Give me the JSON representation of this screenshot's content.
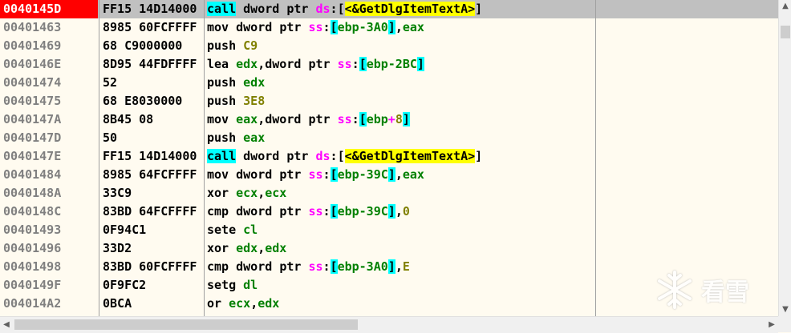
{
  "rows": [
    {
      "addr": "0040145D",
      "bytes": "FF15 14D14000",
      "mn": "call",
      "type": "call",
      "sel": true
    },
    {
      "addr": "00401463",
      "bytes": "8985 60FCFFFF",
      "mn": "mov",
      "type": "movstore",
      "mem": "ebp-3A0",
      "src": "eax"
    },
    {
      "addr": "00401469",
      "bytes": "68 C9000000",
      "mn": "push",
      "type": "pushimm",
      "op": "C9"
    },
    {
      "addr": "0040146E",
      "bytes": "8D95 44FDFFFF",
      "mn": "lea",
      "type": "lea",
      "reg": "edx",
      "mem": "ebp-2BC"
    },
    {
      "addr": "00401474",
      "bytes": "52",
      "mn": "push",
      "type": "pushreg",
      "op": "edx"
    },
    {
      "addr": "00401475",
      "bytes": "68 E8030000",
      "mn": "push",
      "type": "pushimm",
      "op": "3E8"
    },
    {
      "addr": "0040147A",
      "bytes": "8B45 08",
      "mn": "mov",
      "type": "movload",
      "reg": "eax",
      "memreg": "ebp",
      "memsign": "+",
      "memoff": "8"
    },
    {
      "addr": "0040147D",
      "bytes": "50",
      "mn": "push",
      "type": "pushreg",
      "op": "eax"
    },
    {
      "addr": "0040147E",
      "bytes": "FF15 14D14000",
      "mn": "call",
      "type": "call"
    },
    {
      "addr": "00401484",
      "bytes": "8985 64FCFFFF",
      "mn": "mov",
      "type": "movstore",
      "mem": "ebp-39C",
      "src": "eax"
    },
    {
      "addr": "0040148A",
      "bytes": "33C9",
      "mn": "xor",
      "type": "xor",
      "r1": "ecx",
      "r2": "ecx"
    },
    {
      "addr": "0040148C",
      "bytes": "83BD 64FCFFFF",
      "mn": "cmp",
      "type": "cmpmem",
      "mem": "ebp-39C",
      "imm": "0"
    },
    {
      "addr": "00401493",
      "bytes": "0F94C1",
      "mn": "sete",
      "type": "setcc",
      "op": "cl"
    },
    {
      "addr": "00401496",
      "bytes": "33D2",
      "mn": "xor",
      "type": "xor",
      "r1": "edx",
      "r2": "edx"
    },
    {
      "addr": "00401498",
      "bytes": "83BD 60FCFFFF",
      "mn": "cmp",
      "type": "cmpmem",
      "mem": "ebp-3A0",
      "imm": "E"
    },
    {
      "addr": "0040149F",
      "bytes": "0F9FC2",
      "mn": "setg",
      "type": "setcc",
      "op": "dl"
    },
    {
      "addr": "004014A2",
      "bytes": "0BCA",
      "mn": "or",
      "type": "xor",
      "r1": "ecx",
      "r2": "edx"
    }
  ],
  "kw": {
    "dword": "dword",
    "ptr": "ptr",
    "ds": "ds",
    "ss": "ss",
    "api": "<&GetDlgItemTextA>"
  },
  "watermark": {
    "text": "看雪"
  },
  "colors": {
    "background": "#fffbf0",
    "selected_addr": "#ff0000",
    "call_highlight": "#00ffff",
    "api_highlight": "#ffff00",
    "register": "#008000",
    "immediate": "#808000",
    "segment": "#ff00ff",
    "address": "#808080"
  }
}
